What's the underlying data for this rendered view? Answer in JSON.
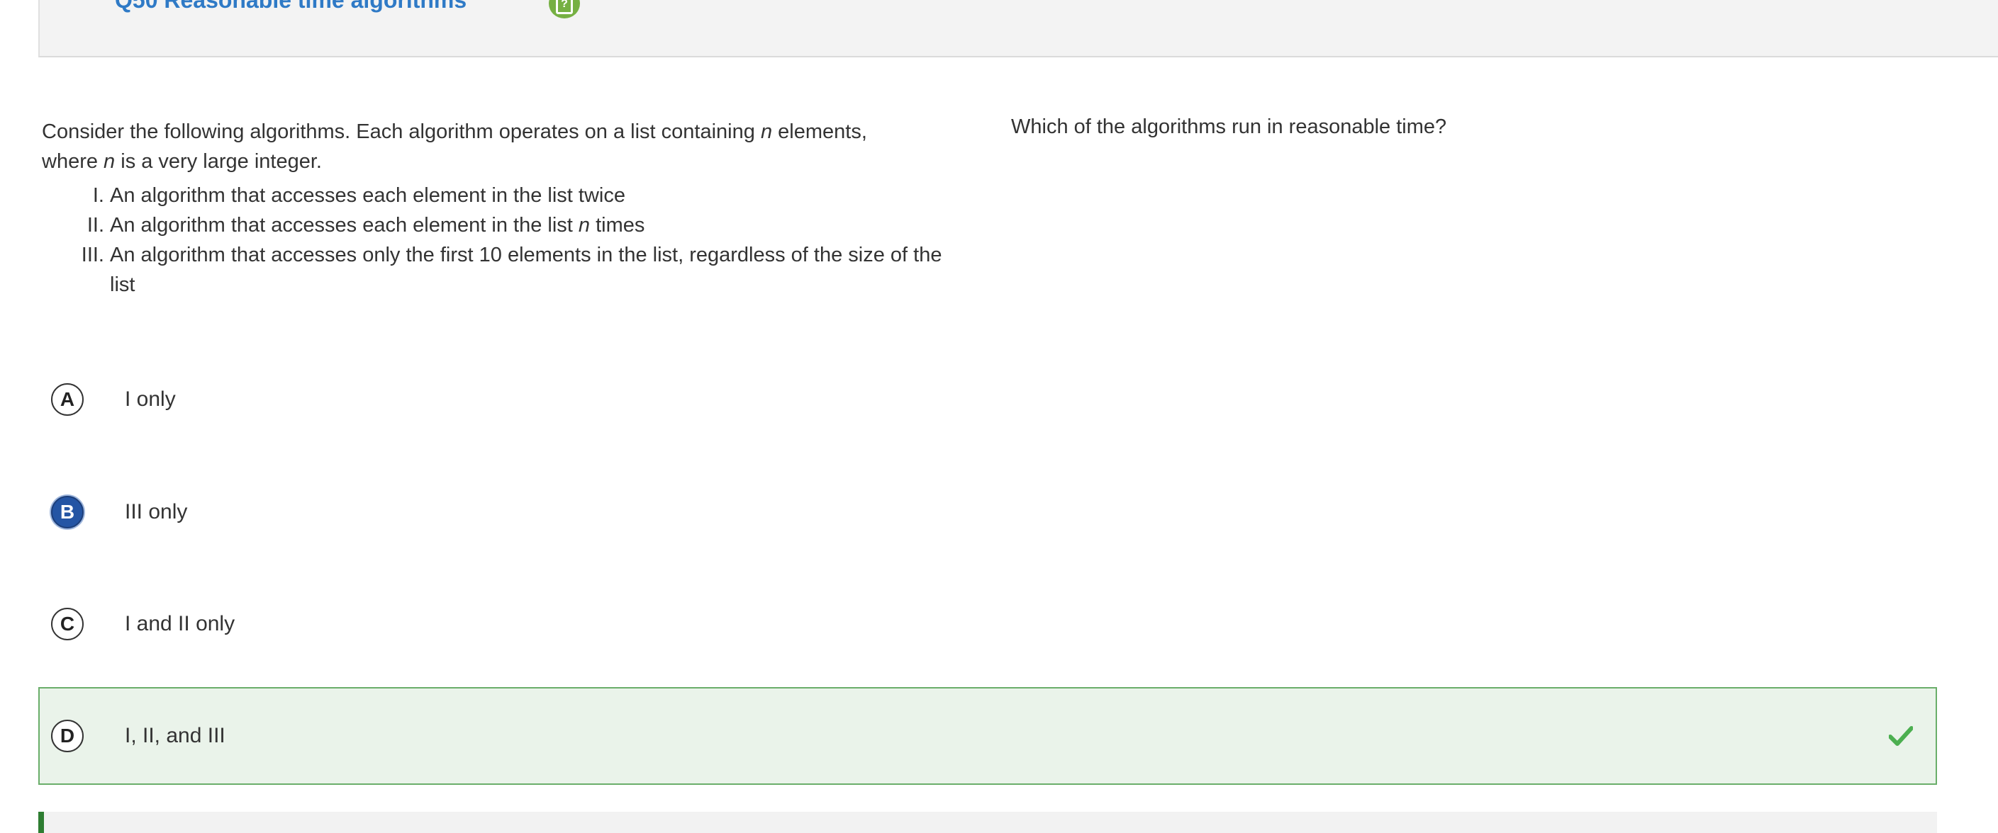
{
  "header": {
    "title": "Q50 Reasonable time algorithms",
    "help_icon": "question-mark-icon",
    "help_color": "#76b043"
  },
  "stimulus": {
    "intro_1": "Consider the following algorithms. Each algorithm operates on a list containing ",
    "intro_var": "n",
    "intro_2": " elements,",
    "intro_3": "where ",
    "intro_var2": "n",
    "intro_4": " is a very large integer.",
    "items": [
      {
        "num": "I.",
        "text_1": "An algorithm that accesses each element in the list twice",
        "var": "",
        "text_2": ""
      },
      {
        "num": "II.",
        "text_1": "An algorithm that accesses each element in the list ",
        "var": "n",
        "text_2": " times"
      },
      {
        "num": "III.",
        "text_1": "An algorithm that accesses only the first 10 elements in the list, regardless of the size of the list",
        "var": "",
        "text_2": ""
      }
    ]
  },
  "stem": "Which of the algorithms run in reasonable time?",
  "options": [
    {
      "letter": "A",
      "text": "I only",
      "selected": false,
      "correct": false
    },
    {
      "letter": "B",
      "text": "III only",
      "selected": true,
      "correct": false
    },
    {
      "letter": "C",
      "text": "I and II only",
      "selected": false,
      "correct": false
    },
    {
      "letter": "D",
      "text": "I, II, and III",
      "selected": false,
      "correct": true
    }
  ],
  "colors": {
    "selected": "#2455a4",
    "correct_bg": "#eaf3ea",
    "correct_border": "#6aae6a",
    "check": "#4caf50"
  },
  "icons": {
    "correct": "checkmark-icon"
  }
}
